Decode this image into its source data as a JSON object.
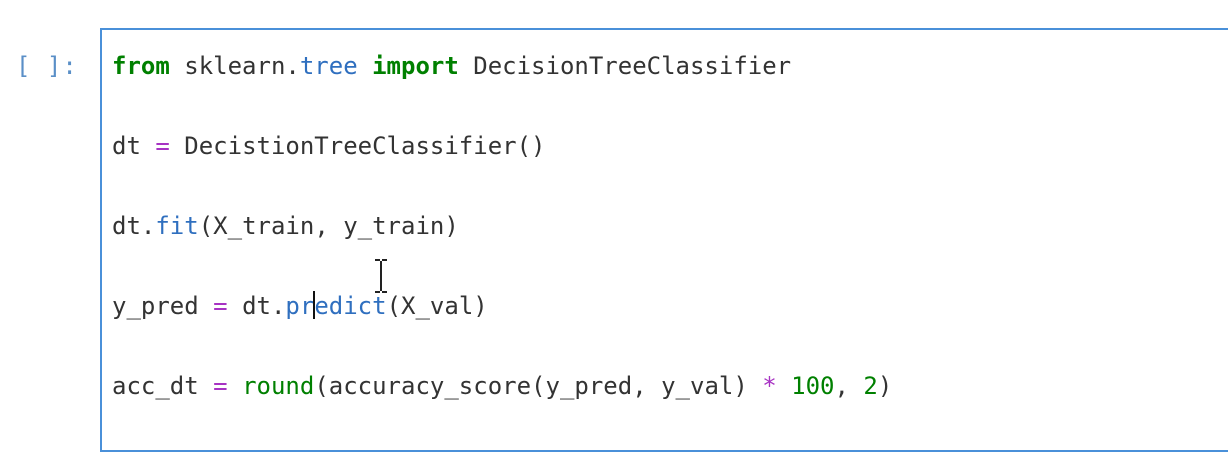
{
  "cell": {
    "prompt": "[ ]:",
    "code": {
      "line1": {
        "kw_from": "from",
        "module_a": " sklearn.",
        "module_b": "tree",
        "kw_import": " import",
        "classname": " DecisionTreeClassifier"
      },
      "line2": {
        "var": "dt",
        "eq": " = ",
        "call": "DecistionTreeClassifier()"
      },
      "line3": {
        "obj": "dt.",
        "method": "fit",
        "args": "(X_train, y_train)"
      },
      "line4": {
        "var": "y_pred",
        "eq": " = ",
        "obj": "dt.",
        "method_a": "pr",
        "method_b": "edict",
        "args": "(X_val)"
      },
      "line5": {
        "var": "acc_dt",
        "eq": " = ",
        "builtin": "round",
        "args_a": "(accuracy_score(y_pred, y_val) ",
        "star": "*",
        "space": " ",
        "num1": "100",
        "comma": ", ",
        "num2": "2",
        "close": ")"
      }
    }
  },
  "colors": {
    "cell_border": "#4a90d9",
    "prompt": "#5a8fc7",
    "keyword": "#008000",
    "attribute": "#2f6fbf",
    "operator": "#a733c3",
    "text": "#333333"
  },
  "icons": {
    "cursor": "text-ibeam-cursor-icon"
  }
}
